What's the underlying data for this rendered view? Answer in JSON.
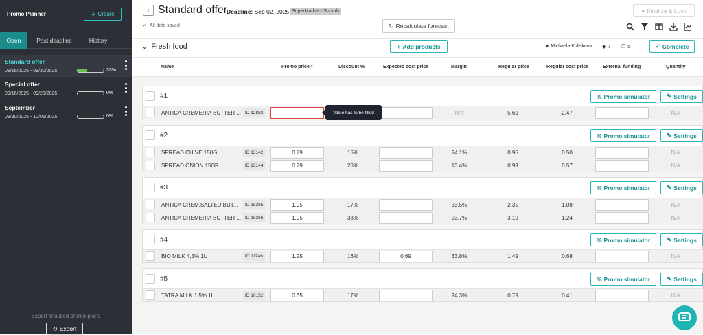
{
  "app": {
    "title": "Promo Planner",
    "create_label": "Create"
  },
  "sidebar": {
    "tabs": [
      "Open",
      "Past deadline",
      "History"
    ],
    "plans": [
      {
        "name": "Standard offer",
        "dates": "09/16/2025 - 09/30/2025",
        "progress": 0.33,
        "pct": "33%"
      },
      {
        "name": "Special offer",
        "dates": "09/16/2025 - 09/23/2025",
        "progress": 0,
        "pct": "0%"
      },
      {
        "name": "September",
        "dates": "09/30/2025 - 10/01/2025",
        "progress": 0,
        "pct": "0%"
      }
    ],
    "footer_text": "Export finalized promo plans",
    "export_label": "Export"
  },
  "header": {
    "title": "Standard offer",
    "deadline_label": "Deadline:",
    "deadline_value": "Sep 02, 2025",
    "store_badge": "SuperMarket - Suburb",
    "saved_text": "All data saved",
    "recalc_label": "Recalculate forecast",
    "finalize_label": "Finalize & Lock"
  },
  "section": {
    "title": "Fresh food",
    "add_products_label": "Add products",
    "owner": "Michaela Kuliskova",
    "tag_count": "7",
    "copy_count": "5",
    "complete_label": "Complete"
  },
  "columns": {
    "name": "Name",
    "promo_price": "Promo price",
    "required_mark": "*",
    "discount": "Discount %",
    "expected_cost": "Expected cost price",
    "margin": "Margin",
    "regular_price": "Regular price",
    "regular_cost": "Regular cost price",
    "external_funding": "External funding",
    "quantity": "Quantity"
  },
  "group_actions": {
    "promo_sim_label": "Promo simulator",
    "settings_label": "Settings"
  },
  "groups": [
    {
      "label": "#1",
      "rows": [
        {
          "name": "ANTICA CREMERIA BUTTER ...",
          "id": "ID 12882",
          "promo_price": "",
          "discount": "",
          "expected_cost": "",
          "margin": "N/A",
          "regular_price": "5.69",
          "regular_cost": "2.47",
          "quantity": "N/A"
        }
      ]
    },
    {
      "label": "#2",
      "rows": [
        {
          "name": "SPREAD CHIVE 150G",
          "id": "ID 13142",
          "promo_price": "0.79",
          "discount": "16%",
          "expected_cost": "",
          "margin": "24.1%",
          "regular_price": "0.95",
          "regular_cost": "0.50",
          "quantity": "N/A"
        },
        {
          "name": "SPREAD ONION 150G",
          "id": "ID 13144",
          "promo_price": "0.79",
          "discount": "20%",
          "expected_cost": "",
          "margin": "13.4%",
          "regular_price": "0.99",
          "regular_cost": "0.57",
          "quantity": "N/A"
        }
      ]
    },
    {
      "label": "#3",
      "rows": [
        {
          "name": "ANTICA CREM.SALTED BUT...",
          "id": "ID 18365",
          "promo_price": "1.95",
          "discount": "17%",
          "expected_cost": "",
          "margin": "33.5%",
          "regular_price": "2.35",
          "regular_cost": "1.08",
          "quantity": "N/A"
        },
        {
          "name": "ANTICA CREMERIA BUTTER ...",
          "id": "ID 18366",
          "promo_price": "1.95",
          "discount": "38%",
          "expected_cost": "",
          "margin": "23.7%",
          "regular_price": "3.19",
          "regular_cost": "1.24",
          "quantity": "N/A"
        }
      ]
    },
    {
      "label": "#4",
      "rows": [
        {
          "name": "BIO MILK 4,5% 1L",
          "id": "ID 11746",
          "promo_price": "1.25",
          "discount": "16%",
          "expected_cost": "0.69",
          "margin": "33.8%",
          "regular_price": "1.49",
          "regular_cost": "0.68",
          "quantity": "N/A"
        }
      ]
    },
    {
      "label": "#5",
      "rows": [
        {
          "name": "TATRA MILK 1,5% 1L",
          "id": "ID 10152",
          "promo_price": "0.65",
          "discount": "17%",
          "expected_cost": "",
          "margin": "24.3%",
          "regular_price": "0.79",
          "regular_cost": "0.41",
          "quantity": "N/A"
        }
      ]
    }
  ],
  "tooltip": "Value has to be filled",
  "colors": {
    "sidebar_bg": "#2b2f36",
    "accent": "#2eb5b5",
    "active_tab": "#1a8c8c",
    "error": "#d84040",
    "progress": "#6cc04a"
  }
}
